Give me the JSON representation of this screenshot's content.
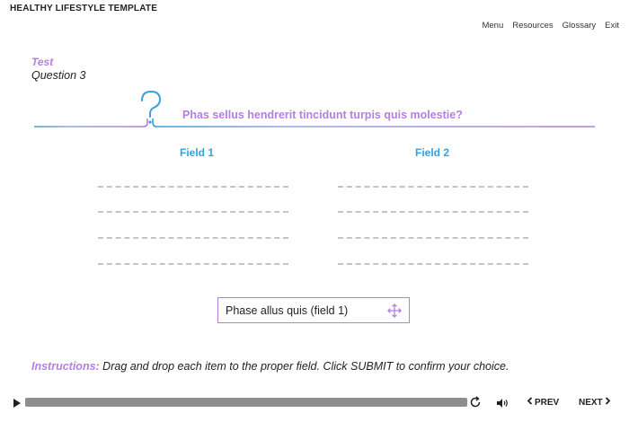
{
  "header": {
    "title": "HEALTHY LIFESTYLE TEMPLATE"
  },
  "nav": {
    "items": [
      "Menu",
      "Resources",
      "Glossary",
      "Exit"
    ]
  },
  "content": {
    "section_label": "Test",
    "question_number": "Question 3",
    "question_text": "Phas sellus hendrerit tincidunt turpis quis molestie?",
    "fields": [
      "Field 1",
      "Field 2"
    ],
    "drag_item": {
      "label": "Phase allus quis (field 1)"
    },
    "instructions_lead": "Instructions:",
    "instructions_text": " Drag and drop each item to the proper field. Click SUBMIT to confirm your choice."
  },
  "player": {
    "progress": 1.0,
    "prev_label": "PREV",
    "next_label": "NEXT"
  },
  "colors": {
    "accent_purple": "#b57ee0",
    "accent_blue": "#3aa0d8",
    "progress_fill": "#8e8e8e"
  }
}
